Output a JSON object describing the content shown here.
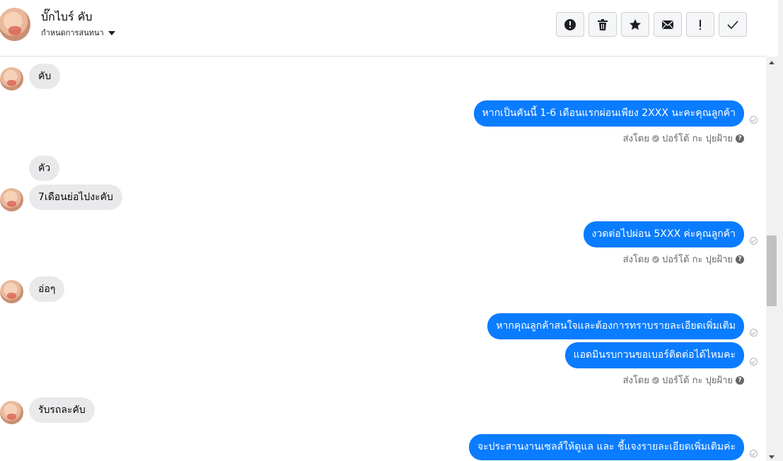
{
  "header": {
    "name": "บั๊กไบร์ คับ",
    "subtitle": "กำหนดการสนทนา",
    "actions": [
      {
        "name": "alert-circle-button",
        "label": "!"
      },
      {
        "name": "delete-button",
        "label": "trash"
      },
      {
        "name": "star-button",
        "label": "star"
      },
      {
        "name": "mail-button",
        "label": "envelope"
      },
      {
        "name": "important-button",
        "label": "!"
      },
      {
        "name": "done-button",
        "label": "check"
      }
    ]
  },
  "thread": {
    "incoming": [
      "คับ",
      "คัว",
      "7เดือนย่อไปงะคับ",
      "อ่อๆ",
      "รับรถละคับ"
    ],
    "outgoing": [
      "หากเป็นคันนี้ 1-6 เดือนแรกผ่อนเพียง 2XXX นะคะคุณลูกค้า",
      "งวดต่อไปผ่อน 5XXX  ค่ะคุณลูกค้า",
      "หากคุณลูกค้าสนใจและต้องการทราบรายละเอียดเพิ่มเติม",
      "แอดมินรบกวนขอเบอร์ติดต่อได้ไหมคะ",
      "จะประสานงานเซลส์ให้ดูแล และ ชี้แจงรายละเอียดเพิ่มเติมค่ะ"
    ],
    "sent_by_label": "ส่งโดย",
    "sender": "ปอร์โต้ กะ ปุยฝ้าย",
    "help": "?"
  }
}
